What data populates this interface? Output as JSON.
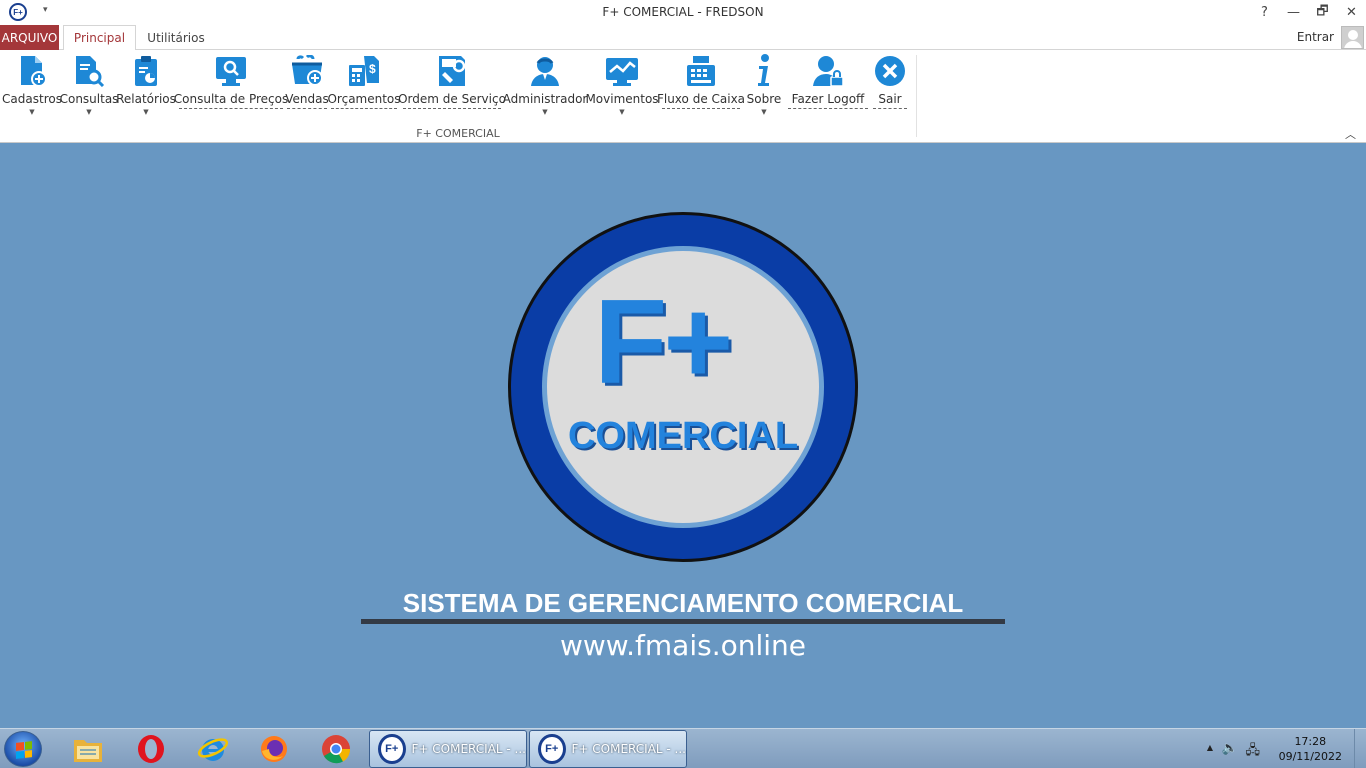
{
  "window": {
    "app_icon_text": "F+",
    "title": "F+ COMERCIAL - FREDSON",
    "help": "?",
    "minimize": "—",
    "restore": "🗗",
    "close": "✕"
  },
  "tabs": {
    "file": "ARQUIVO",
    "items": [
      "Principal",
      "Utilitários"
    ],
    "active": "Principal",
    "signin": "Entrar"
  },
  "ribbon": {
    "group_label": "F+ COMERCIAL",
    "buttons": [
      {
        "label": "Cadastros",
        "icon": "document-add-icon",
        "dropdown": true
      },
      {
        "label": "Consultas",
        "icon": "document-search-icon",
        "dropdown": true
      },
      {
        "label": "Relatórios",
        "icon": "clipboard-chart-icon",
        "dropdown": true
      },
      {
        "label": "Consulta de Preços",
        "icon": "monitor-search-icon",
        "dropdown": false
      },
      {
        "label": "Vendas",
        "icon": "shopping-basket-icon",
        "dropdown": false
      },
      {
        "label": "Orçamentos",
        "icon": "calculator-document-icon",
        "dropdown": false
      },
      {
        "label": "Ordem de Serviço",
        "icon": "service-order-icon",
        "dropdown": false
      },
      {
        "label": "Administrador",
        "icon": "admin-user-icon",
        "dropdown": true
      },
      {
        "label": "Movimentos",
        "icon": "monitor-chart-icon",
        "dropdown": true
      },
      {
        "label": "Fluxo de Caixa",
        "icon": "cash-register-icon",
        "dropdown": false
      },
      {
        "label": "Sobre",
        "icon": "info-icon",
        "dropdown": true
      },
      {
        "label": "Fazer Logoff",
        "icon": "user-lock-icon",
        "dropdown": false
      },
      {
        "label": "Sair",
        "icon": "close-circle-icon",
        "dropdown": false
      }
    ]
  },
  "main": {
    "logo_mark": "F+",
    "logo_text": "COMERCIAL",
    "tagline": "SISTEMA DE GERENCIAMENTO COMERCIAL",
    "website": "www.fmais.online",
    "bg_color": "#6897c2",
    "accent_color": "#2383dd"
  },
  "taskbar": {
    "tasks": [
      "F+ COMERCIAL - ...",
      "F+ COMERCIAL - ..."
    ],
    "task_icon_text": "F+",
    "time": "17:28",
    "date": "09/11/2022"
  }
}
